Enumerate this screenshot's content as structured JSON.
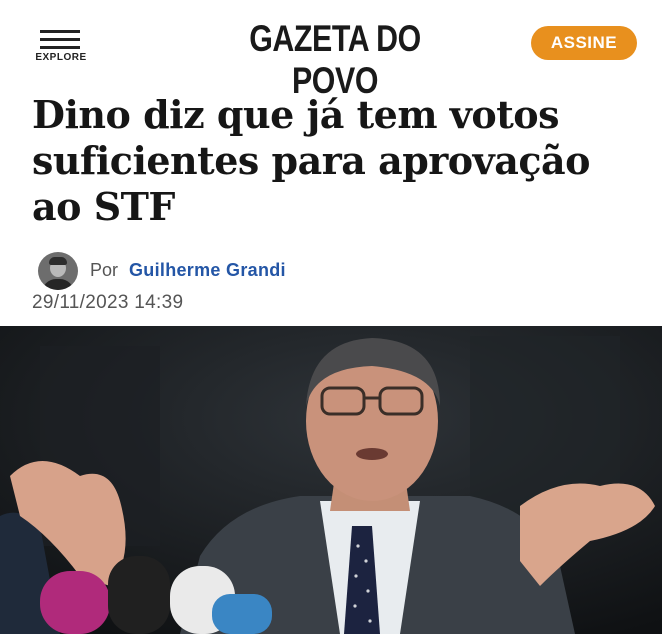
{
  "header": {
    "explore_label": "EXPLORE",
    "logo_text": "GAZETA DO POVO",
    "subscribe_label": "ASSINE"
  },
  "article": {
    "headline_lines": [
      "Dino diz que já tem votos",
      "suficientes para aprovação",
      "ao STF"
    ],
    "byline_prefix": "Por",
    "author": "Guilherme Grandi",
    "datetime": "29/11/2023 14:39"
  },
  "icons": {
    "menu": "hamburger-menu-icon"
  },
  "colors": {
    "subscribe_button": "#e8901e",
    "author_link": "#2456a6",
    "headline": "#161616"
  }
}
